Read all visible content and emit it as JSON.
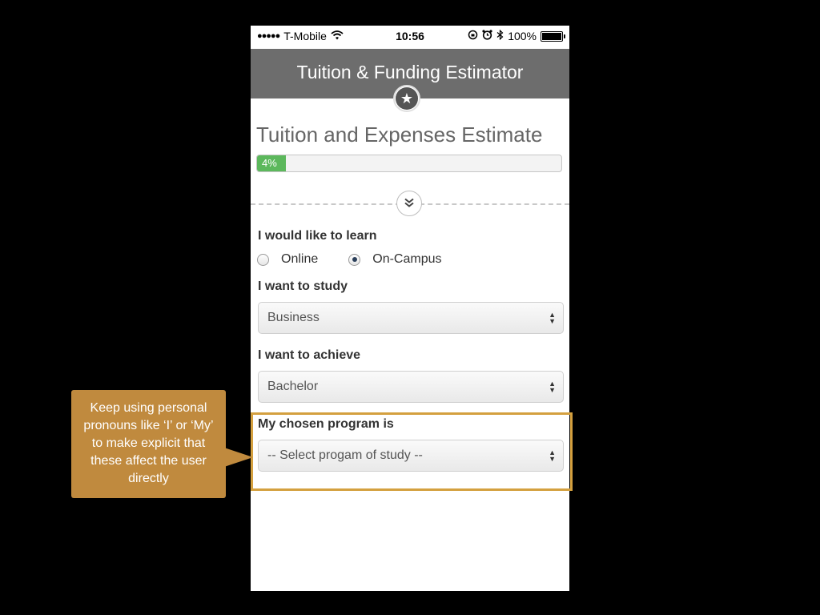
{
  "status_bar": {
    "carrier": "T-Mobile",
    "time": "10:56",
    "battery": "100%"
  },
  "header": {
    "title": "Tuition & Funding Estimator"
  },
  "page": {
    "heading": "Tuition and Expenses Estimate",
    "progress_label": "4%",
    "progress_value": 0.04
  },
  "form": {
    "learn_label": "I would like to learn",
    "learn_options": [
      {
        "label": "Online",
        "checked": false
      },
      {
        "label": "On-Campus",
        "checked": true
      }
    ],
    "study_label": "I want to study",
    "study_value": "Business",
    "achieve_label": "I want to achieve",
    "achieve_value": "Bachelor",
    "program_label": "My chosen program is",
    "program_value": "-- Select progam of study --"
  },
  "annotation": {
    "callout_text": "Keep using personal pronouns like ‘I’ or ‘My’ to make explicit that these affect the user directly",
    "accent_color": "#d4a03f",
    "callout_color": "#c08a3e"
  },
  "colors": {
    "header_bg": "#6d6d6d",
    "progress_fill": "#5cb85c"
  }
}
